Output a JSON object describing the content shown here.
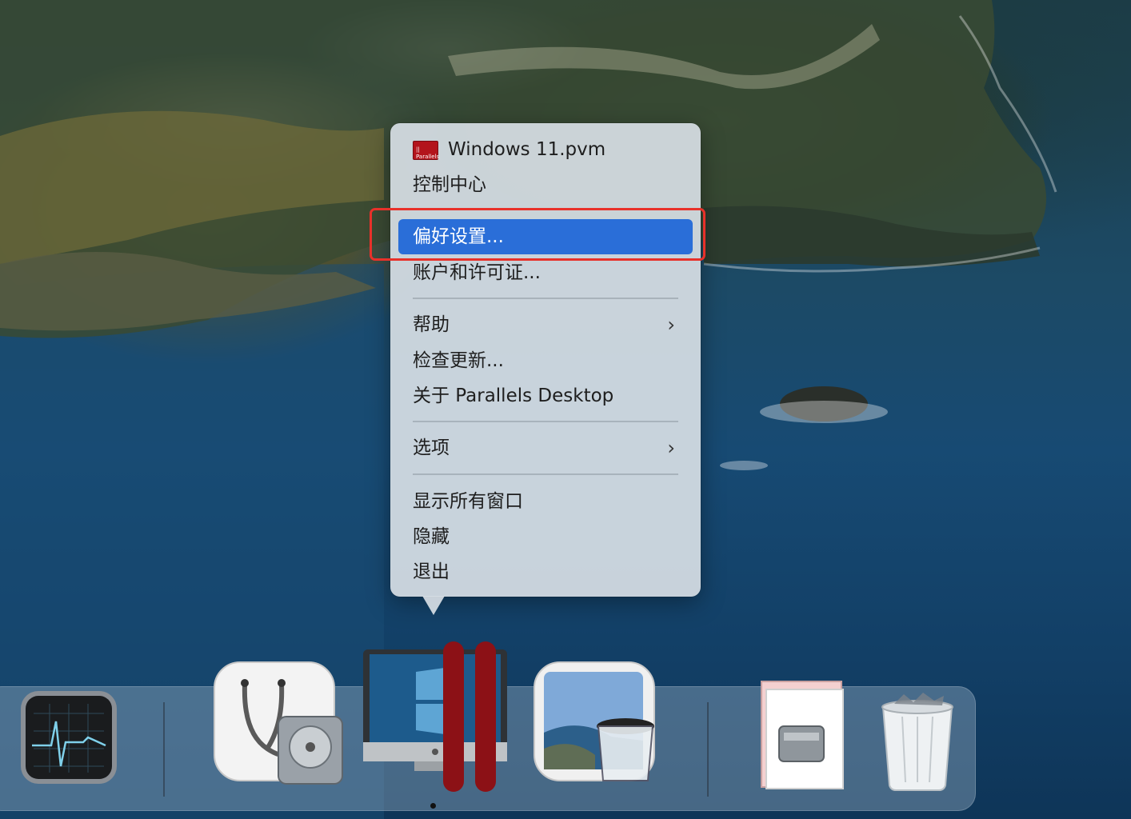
{
  "menu": {
    "items": [
      {
        "label": "Windows 11.pvm",
        "icon": "parallels-vm-icon"
      },
      {
        "label": "控制中心"
      },
      {
        "label": "偏好设置...",
        "highlighted": true
      },
      {
        "label": "账户和许可证..."
      },
      {
        "label": "帮助",
        "submenu": true
      },
      {
        "label": "检查更新..."
      },
      {
        "label": "关于 Parallels Desktop"
      },
      {
        "label": "选项",
        "submenu": true
      },
      {
        "label": "显示所有窗口"
      },
      {
        "label": "隐藏"
      },
      {
        "label": "退出"
      }
    ],
    "vm_icon_text": "|| Parallels",
    "chevron": "›"
  },
  "dock": {
    "apps": [
      {
        "name": "Activity Monitor",
        "icon": "activity-monitor-icon"
      },
      {
        "name": "Disk Utility",
        "icon": "disk-utility-icon"
      },
      {
        "name": "Parallels Desktop",
        "icon": "parallels-desktop-icon",
        "running": true
      },
      {
        "name": "Preview",
        "icon": "preview-icon"
      },
      {
        "name": "Disk Image",
        "icon": "disk-image-icon"
      },
      {
        "name": "Trash",
        "icon": "trash-icon"
      }
    ]
  },
  "colors": {
    "highlight": "#2a6ed8",
    "annotation_box": "#e8312a"
  }
}
